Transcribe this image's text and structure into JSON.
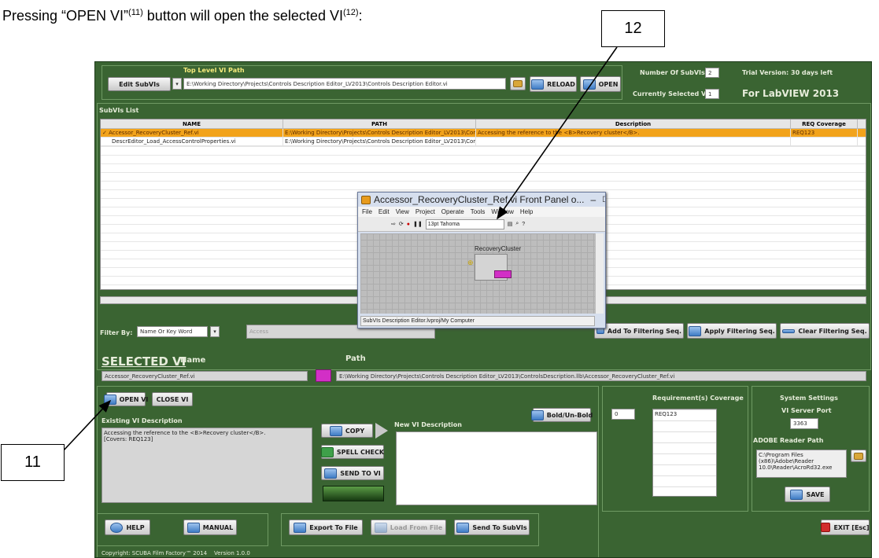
{
  "caption": {
    "prefix": "Pressing “OPEN VI”",
    "sup1": "(11)",
    "middle": " button will open the selected VI",
    "sup2": "(12)",
    "suffix": ":"
  },
  "callouts": {
    "c11": "11",
    "c12": "12"
  },
  "top": {
    "edit_subvis": "Edit SubVIs",
    "top_level_label": "Top Level VI Path",
    "top_level_path": "E:\\Working Directory\\Projects\\Controls Description Editor_LV2013\\Controls Description Editor.vi",
    "reload": "RELOAD",
    "open": "OPEN",
    "num_subvis_label": "Number Of SubVIs",
    "num_subvis": "2",
    "current_label": "Currently Selected VI",
    "current": "1",
    "trial": "Trial Version: 30 days left",
    "for_labview": "For LabVIEW 2013"
  },
  "subvis": {
    "title": "SubVIs List",
    "headers": [
      "NAME",
      "PATH",
      "Description",
      "REQ Coverage"
    ],
    "rows": [
      {
        "check": "✓",
        "name": "Accessor_RecoveryCluster_Ref.vi",
        "path": "E:\\Working Directory\\Projects\\Controls Description Editor_LV2013\\Cont",
        "desc": "Accessing the reference to the <B>Recovery cluster</B>.",
        "req": "REQ123"
      },
      {
        "check": "",
        "name": "DescrEditor_Load_AccessControlProperties.vi",
        "path": "E:\\Working Directory\\Projects\\Controls Description Editor_LV2013\\Cont",
        "desc": "",
        "req": ""
      }
    ]
  },
  "filter": {
    "label": "Filter By:",
    "mode": "Name Or Key Word",
    "value": "Access",
    "add": "Add To Filtering Seq.",
    "apply": "Apply Filtering Seq.",
    "clear": "Clear Filtering Seq."
  },
  "front_panel": {
    "title": "Accessor_RecoveryCluster_Ref.vi Front Panel o...",
    "menu": [
      "File",
      "Edit",
      "View",
      "Project",
      "Operate",
      "Tools",
      "Window",
      "Help"
    ],
    "font": "13pt Tahoma",
    "control_label": "RecoveryCluster",
    "status": "SubVIs Description Editor.lvproj/My Computer"
  },
  "selected": {
    "heading": "SELECTED VI",
    "name_label": "Name",
    "path_label": "Path",
    "name": "Accessor_RecoveryCluster_Ref.vi",
    "path": "E:\\Working Directory\\Projects\\Controls Description Editor_LV2013\\ControlsDescription.llb\\Accessor_RecoveryCluster_Ref.vi",
    "open_vi": "OPEN VI",
    "close_vi": "CLOSE VI",
    "existing_label": "Existing VI Description",
    "existing_text": "Accessing the reference to the <B>Recovery cluster</B>.\n[Covers: REQ123]",
    "copy": "COPY",
    "spell": "SPELL CHECK",
    "send_vi": "SEND TO VI",
    "new_label": "New VI Description",
    "bold": "Bold/Un-Bold"
  },
  "req": {
    "label": "Requirement(s) Coverage",
    "index": "0",
    "items": [
      "REQ123"
    ]
  },
  "settings": {
    "label": "System Settings",
    "port_label": "VI Server Port",
    "port": "3363",
    "adobe_label": "ADOBE Reader Path",
    "adobe_path": "C:\\Program Files (x86)\\Adobe\\Reader 10.0\\Reader\\AcroRd32.exe",
    "save": "SAVE"
  },
  "bottom": {
    "help": "HELP",
    "manual": "MANUAL",
    "export": "Export To File",
    "load": "Load From File",
    "send_subvis": "Send To SubVIs",
    "exit": "EXIT [Esc]",
    "copyright": "Copyright: SCUBA Film Factory™ 2014",
    "version": "Version 1.0.0"
  }
}
